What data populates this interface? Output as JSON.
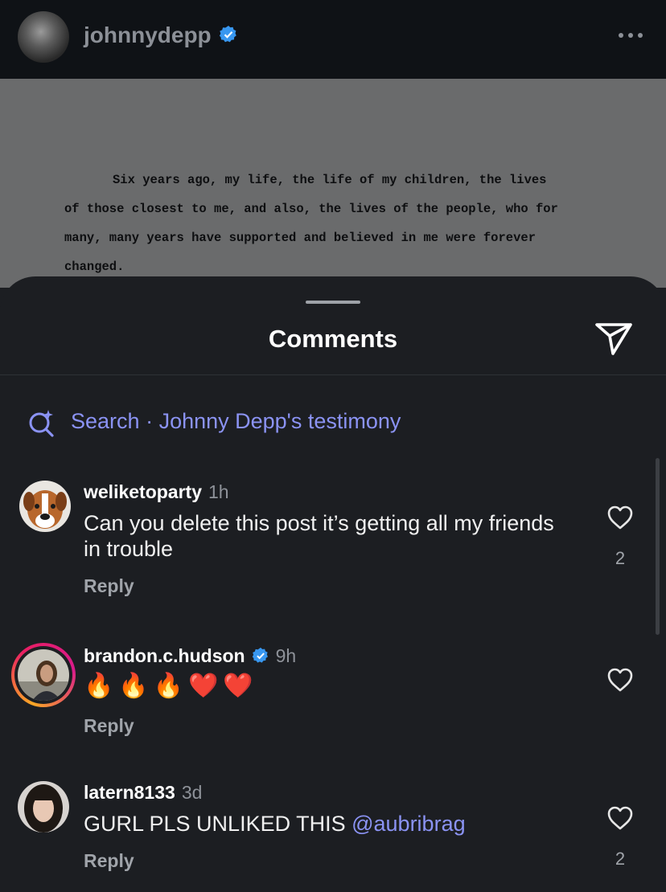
{
  "header": {
    "username": "johnnydepp",
    "verified": true,
    "more_icon": "more-icon"
  },
  "post": {
    "text_lines": [
      "Six years ago, my life, the life of my children, the lives",
      "of those closest to me, and also, the lives of the people, who for",
      "many, many years have supported and believed in me were forever",
      "changed."
    ]
  },
  "comments_sheet": {
    "title": "Comments",
    "send_icon": "send-icon",
    "search_prefix": "Search",
    "search_separator": " · ",
    "search_query": "Johnny Depp's testimony",
    "reply_label": "Reply",
    "comments": [
      {
        "username": "weliketoparty",
        "time": "1h",
        "text": "Can you delete this post it’s getting all my friends in trouble",
        "likes": "2"
      },
      {
        "username": "brandon.c.hudson",
        "verified": true,
        "time": "9h",
        "text": "🔥🔥🔥❤️❤️",
        "likes": ""
      },
      {
        "username": "latern8133",
        "time": "3d",
        "text": "GURL PLS UNLIKED THIS ",
        "mention": "@aubribrag",
        "likes": "2"
      }
    ]
  },
  "colors": {
    "accent": "#8b93f4",
    "verified_blue": "#3897f0",
    "background": "#1c1e22",
    "story_ring_start": "#f9a825",
    "story_ring_end": "#d81b8a"
  }
}
